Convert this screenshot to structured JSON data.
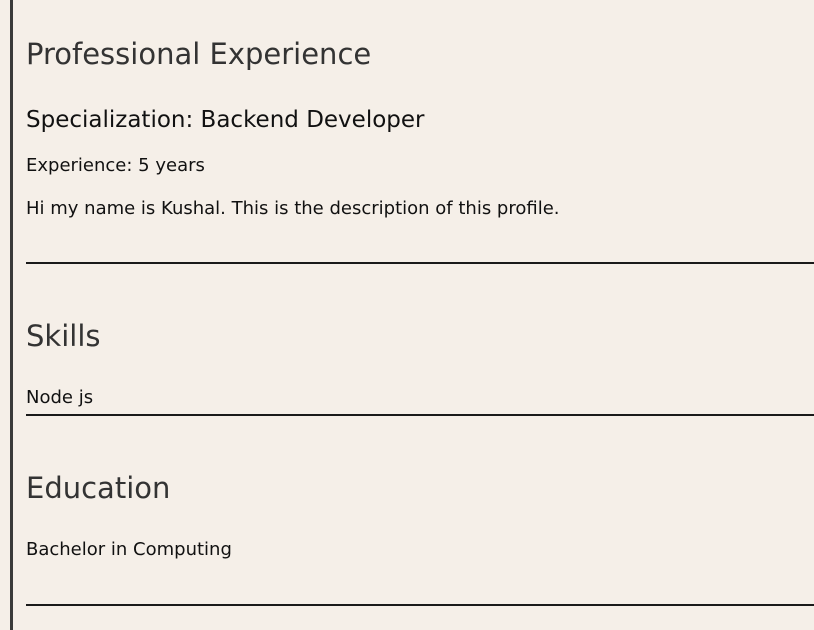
{
  "experience": {
    "heading": "Professional Experience",
    "specialization": "Specialization: Backend Developer",
    "years": "Experience: 5 years",
    "description": "Hi my name is Kushal. This is the description of this profile."
  },
  "skills": {
    "heading": "Skills",
    "items": [
      "Node js"
    ]
  },
  "education": {
    "heading": "Education",
    "items": [
      "Bachelor in Computing"
    ]
  },
  "colors": {
    "background": "#f5efe8",
    "heading_text": "#333333",
    "body_text": "#111111",
    "rule": "#1a1a1a"
  }
}
